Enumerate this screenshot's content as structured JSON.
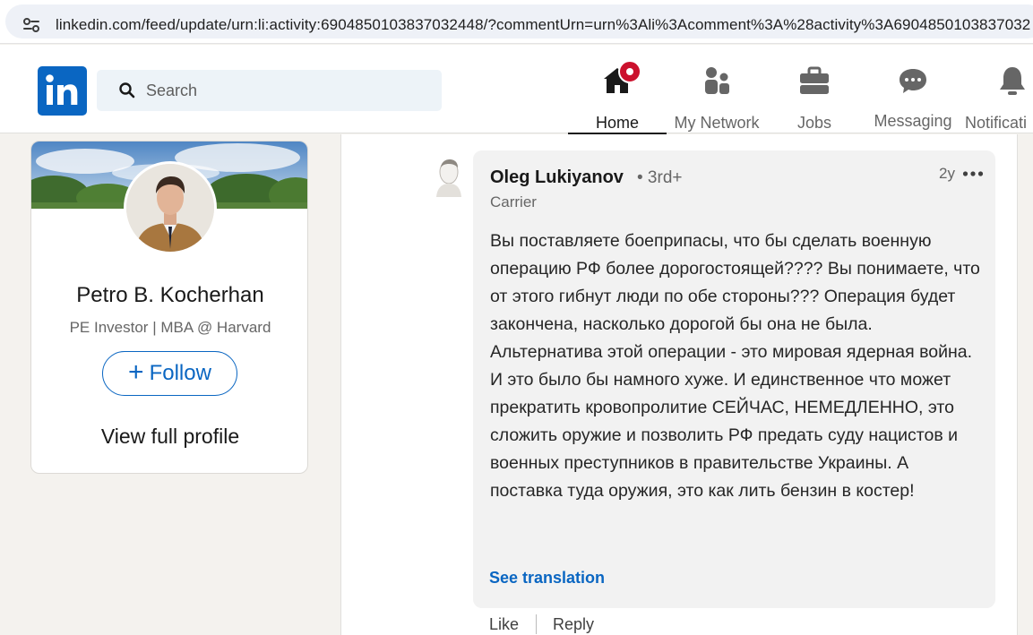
{
  "browser": {
    "url": "linkedin.com/feed/update/urn:li:activity:6904850103837032448/?commentUrn=urn%3Ali%3Acomment%3A%28activity%3A6904850103837032"
  },
  "nav": {
    "search_placeholder": "Search",
    "items": [
      {
        "label": "Home",
        "icon": "home-icon"
      },
      {
        "label": "My Network",
        "icon": "people-icon"
      },
      {
        "label": "Jobs",
        "icon": "briefcase-icon"
      },
      {
        "label": "Messaging",
        "icon": "chat-icon"
      },
      {
        "label": "Notificati",
        "icon": "bell-icon"
      }
    ],
    "brand_color": "#0a66c2",
    "badge_color": "#cb112d"
  },
  "profile": {
    "name": "Petro B. Kocherhan",
    "headline": "PE Investor | MBA @ Harvard",
    "follow_label": "Follow",
    "view_profile_label": "View full profile"
  },
  "comment": {
    "author": "Oleg Lukiyanov",
    "degree": "• 3rd+",
    "title": "Carrier",
    "time": "2y",
    "text": "Вы поставляете боеприпасы, что бы сделать военную операцию РФ более дорогостоящей???? Вы понимаете, что от этого гибнут люди по обе стороны??? Операция будет закончена, насколько дорогой бы она не была. Альтернатива этой операции - это мировая ядерная война. И это было бы намного хуже. И единственное что может прекратить кровопролитие СЕЙЧАС, НЕМЕДЛЕННО, это сложить оружие и позволить РФ предать суду нацистов и военных преступников в правительстве Украины. А поставка туда оружия, это как лить бензин в костер!",
    "see_translation": "See translation",
    "like_label": "Like",
    "reply_label": "Reply"
  }
}
